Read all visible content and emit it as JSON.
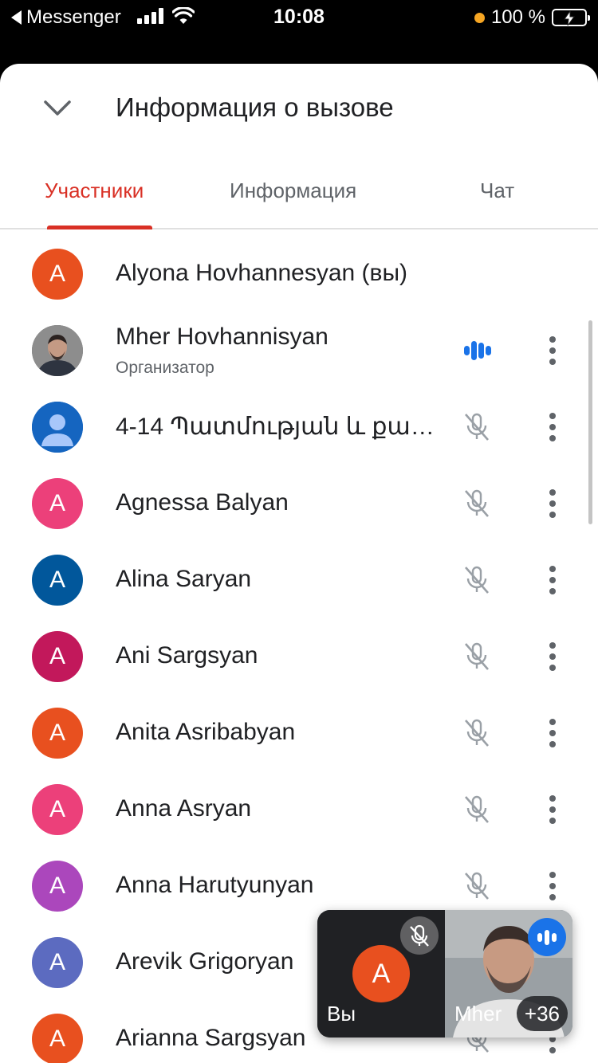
{
  "status_bar": {
    "back_app": "Messenger",
    "time": "10:08",
    "battery": "100 %"
  },
  "header": {
    "title": "Информация о вызове"
  },
  "tabs": [
    {
      "label": "Участники",
      "active": true
    },
    {
      "label": "Информация",
      "active": false
    },
    {
      "label": "Чат",
      "active": false
    }
  ],
  "participants": [
    {
      "name": "Alyona Hovhannesyan (вы)",
      "initial": "A",
      "color": "#e8501f",
      "role": "",
      "mic": "none"
    },
    {
      "name": "Mher Hovhannisyan",
      "initial": "",
      "color": "#6b6b6b",
      "role": "Организатор",
      "mic": "speaking"
    },
    {
      "name": "4-14 Պատմության և քա…",
      "initial": "",
      "color": "#1565c0",
      "role": "",
      "mic": "muted"
    },
    {
      "name": "Agnessa Balyan",
      "initial": "A",
      "color": "#ec407a",
      "role": "",
      "mic": "muted"
    },
    {
      "name": "Alina Saryan",
      "initial": "A",
      "color": "#01579b",
      "role": "",
      "mic": "muted"
    },
    {
      "name": "Ani Sargsyan",
      "initial": "A",
      "color": "#c2185b",
      "role": "",
      "mic": "muted"
    },
    {
      "name": "Anita Asribabyan",
      "initial": "A",
      "color": "#e8501f",
      "role": "",
      "mic": "muted"
    },
    {
      "name": "Anna Asryan",
      "initial": "A",
      "color": "#ec407a",
      "role": "",
      "mic": "muted"
    },
    {
      "name": "Anna Harutyunyan",
      "initial": "A",
      "color": "#ab47bc",
      "role": "",
      "mic": "muted"
    },
    {
      "name": "Arevik Grigoryan",
      "initial": "A",
      "color": "#5c6bc0",
      "role": "",
      "mic": "muted"
    },
    {
      "name": "Arianna Sargsyan",
      "initial": "A",
      "color": "#e8501f",
      "role": "",
      "mic": "muted"
    }
  ],
  "pip": {
    "self_label": "Вы",
    "self_initial": "A",
    "other_label": "Mher",
    "more_count": "+36"
  },
  "colors": {
    "accent": "#d93025",
    "speaking": "#1a73e8"
  }
}
